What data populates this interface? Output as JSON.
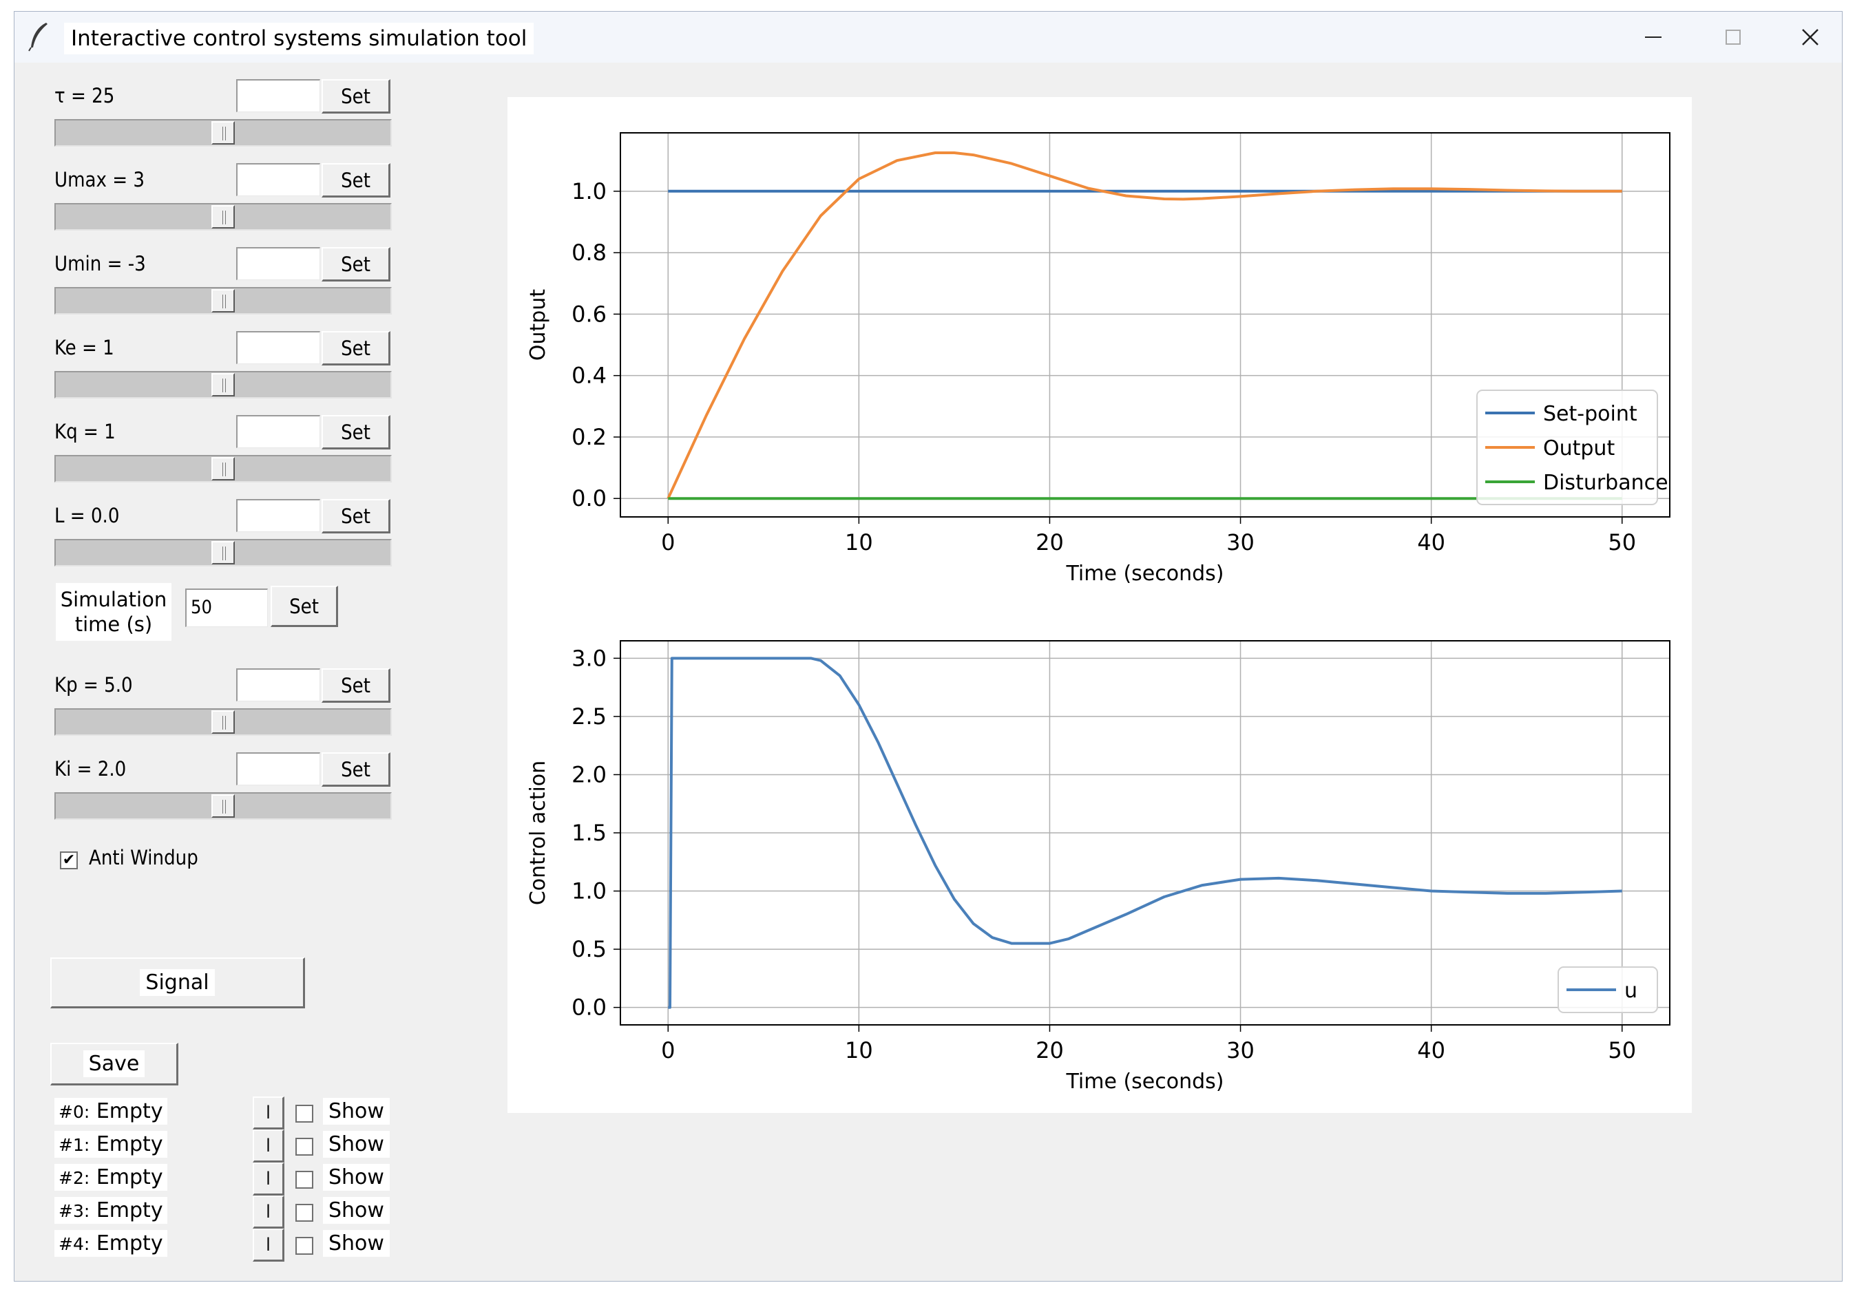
{
  "window": {
    "title": "Interactive control systems simulation tool",
    "minimize_glyph": "—",
    "maximize_glyph": "☐",
    "close_glyph": "✕"
  },
  "params": [
    {
      "label": "τ = 25",
      "entry": "",
      "set_label": "Set",
      "slider_level": 0.5
    },
    {
      "label": "Umax = 3",
      "entry": "",
      "set_label": "Set",
      "slider_level": 0.5
    },
    {
      "label": "Umin = -3",
      "entry": "",
      "set_label": "Set",
      "slider_level": 0.5
    },
    {
      "label": "Ke = 1",
      "entry": "",
      "set_label": "Set",
      "slider_level": 0.5
    },
    {
      "label": "Kq = 1",
      "entry": "",
      "set_label": "Set",
      "slider_level": 0.5
    },
    {
      "label": "L = 0.0",
      "entry": "",
      "set_label": "Set",
      "slider_level": 0.5
    }
  ],
  "simulation": {
    "label_line1": "Simulation",
    "label_line2": "time (s)",
    "value": "50",
    "set_label": "Set"
  },
  "controller_params": [
    {
      "label": "Kp = 5.0",
      "entry": "",
      "set_label": "Set",
      "slider_level": 0.5
    },
    {
      "label": "Ki = 2.0",
      "entry": "",
      "set_label": "Set",
      "slider_level": 0.5
    }
  ],
  "anti_windup": {
    "label": "Anti Windup",
    "checked": true,
    "check_glyph": "✔"
  },
  "signal_button": "Signal",
  "save_button": "Save",
  "slots": [
    {
      "id": "#0:",
      "value": "Empty",
      "load_label": "l",
      "show_label": "Show"
    },
    {
      "id": "#1:",
      "value": "Empty",
      "load_label": "l",
      "show_label": "Show"
    },
    {
      "id": "#2:",
      "value": "Empty",
      "load_label": "l",
      "show_label": "Show"
    },
    {
      "id": "#3:",
      "value": "Empty",
      "load_label": "l",
      "show_label": "Show"
    },
    {
      "id": "#4:",
      "value": "Empty",
      "load_label": "l",
      "show_label": "Show"
    }
  ],
  "colors": {
    "setpoint": "#3a73b1",
    "output": "#f08b3a",
    "disturbance": "#3aa537",
    "u": "#4a80ba"
  },
  "chart_data": [
    {
      "type": "line",
      "xlabel": "Time (seconds)",
      "ylabel": "Output",
      "xlim": [
        -2.5,
        52.5
      ],
      "ylim": [
        -0.06,
        1.19
      ],
      "xticks": [
        "0",
        "10",
        "20",
        "30",
        "40",
        "50"
      ],
      "yticks": [
        "0.0",
        "0.2",
        "0.4",
        "0.6",
        "0.8",
        "1.0"
      ],
      "grid": true,
      "legend_position": "lower-right",
      "series": [
        {
          "name": "Set-point",
          "color": "#3a73b1",
          "x": [
            0,
            50
          ],
          "y": [
            1.0,
            1.0
          ]
        },
        {
          "name": "Output",
          "color": "#f08b3a",
          "x": [
            0,
            2,
            4,
            6,
            8,
            10,
            12,
            14,
            15,
            16,
            18,
            20,
            22,
            24,
            26,
            27,
            28,
            30,
            32,
            34,
            36,
            38,
            40,
            42,
            44,
            46,
            48,
            50
          ],
          "y": [
            0.0,
            0.27,
            0.52,
            0.74,
            0.92,
            1.04,
            1.1,
            1.125,
            1.125,
            1.118,
            1.09,
            1.05,
            1.01,
            0.985,
            0.975,
            0.974,
            0.976,
            0.983,
            0.992,
            1.0,
            1.005,
            1.008,
            1.008,
            1.006,
            1.003,
            1.001,
            1.0,
            1.0
          ]
        },
        {
          "name": "Disturbance",
          "color": "#3aa537",
          "x": [
            0,
            50
          ],
          "y": [
            0.0,
            0.0
          ]
        }
      ]
    },
    {
      "type": "line",
      "xlabel": "Time (seconds)",
      "ylabel": "Control action",
      "xlim": [
        -2.5,
        52.5
      ],
      "ylim": [
        -0.15,
        3.15
      ],
      "xticks": [
        "0",
        "10",
        "20",
        "30",
        "40",
        "50"
      ],
      "yticks": [
        "0.0",
        "0.5",
        "1.0",
        "1.5",
        "2.0",
        "2.5",
        "3.0"
      ],
      "grid": true,
      "legend_position": "lower-right",
      "series": [
        {
          "name": "u",
          "color": "#4a80ba",
          "x": [
            0,
            0.1,
            0.2,
            2,
            4,
            6,
            7.5,
            8,
            9,
            10,
            11,
            12,
            13,
            14,
            15,
            16,
            17,
            18,
            19,
            20,
            21,
            22,
            24,
            26,
            28,
            30,
            32,
            34,
            36,
            38,
            40,
            42,
            44,
            46,
            48,
            50
          ],
          "y": [
            0.0,
            0.0,
            3.0,
            3.0,
            3.0,
            3.0,
            3.0,
            2.98,
            2.85,
            2.6,
            2.28,
            1.92,
            1.56,
            1.22,
            0.93,
            0.72,
            0.6,
            0.55,
            0.55,
            0.55,
            0.59,
            0.66,
            0.8,
            0.95,
            1.05,
            1.1,
            1.11,
            1.09,
            1.06,
            1.03,
            1.0,
            0.99,
            0.98,
            0.98,
            0.99,
            1.0
          ]
        }
      ]
    }
  ]
}
